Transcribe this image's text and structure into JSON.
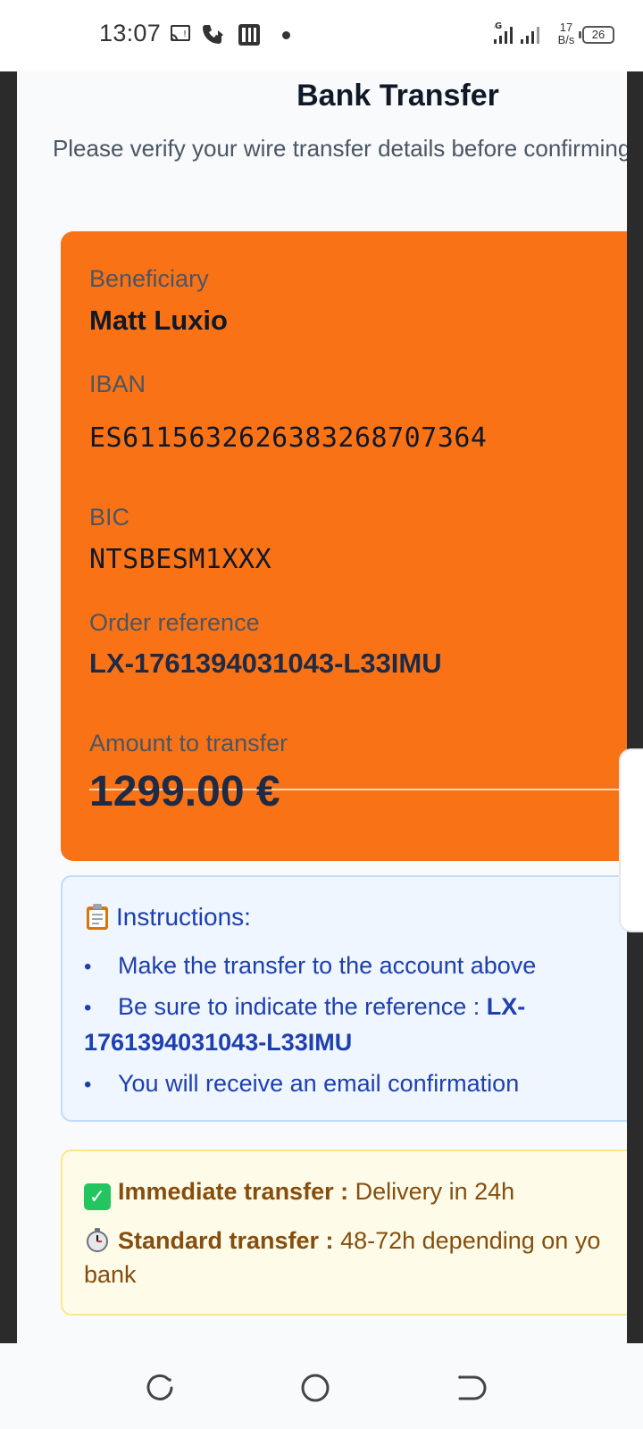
{
  "status_bar": {
    "time": "13:07",
    "left_icons": [
      "cast-icon",
      "wifi-calling-icon",
      "parking-icon"
    ],
    "network_type": "4G",
    "net_speed": "17 B/s",
    "net_speed_value": "17",
    "net_speed_unit": "B/s",
    "battery": "26"
  },
  "modal": {
    "title": "Bank Transfer",
    "subtitle": "Please verify your wire transfer details before confirming your order"
  },
  "bank_details": {
    "beneficiary_label": "Beneficiary",
    "beneficiary_value": "Matt Luxio",
    "iban_label": "IBAN",
    "iban_value": "ES6115632626383268707364",
    "bic_label": "BIC",
    "bic_value": "NTSBESM1XXX",
    "reference_label": "Order reference",
    "reference_value": "LX-1761394031043-L33IMU",
    "amount_label": "Amount to transfer",
    "amount_value": "1299.00 €",
    "card_color": "#f97316"
  },
  "instructions": {
    "heading": "Instructions:",
    "item1": "Make the transfer to the account above",
    "item2_prefix": "Be sure to indicate the reference : ",
    "item2_ref_line1": "LX-",
    "item2_ref_line2": "1761394031043-L33IMU",
    "item3": "You will receive an email confirmation"
  },
  "delivery": {
    "immediate_label": "Immediate transfer :",
    "immediate_text": "Delivery in 24h",
    "standard_label": "Standard transfer :",
    "standard_text_line1": "48-72h depending on yo",
    "standard_text_line2": "bank"
  },
  "nav_bar": {
    "buttons": [
      "recents-icon",
      "home-icon",
      "back-icon"
    ]
  }
}
